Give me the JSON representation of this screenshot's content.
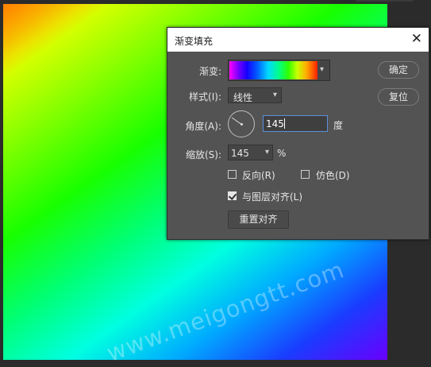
{
  "watermark": "www.meigongtt.com",
  "dialog": {
    "title": "渐变填充",
    "close_glyph": "✕",
    "gradient_label": "渐变:",
    "style_label": "样式(I):",
    "style_value": "线性",
    "angle_label": "角度(A):",
    "angle_value": "145",
    "angle_unit": "度",
    "scale_label": "缩放(S):",
    "scale_value": "145",
    "scale_unit": "%",
    "reverse_label": "反向(R)",
    "reverse_checked": false,
    "dither_label": "仿色(D)",
    "dither_checked": false,
    "align_label": "与图层对齐(L)",
    "align_checked": true,
    "reset_align_label": "重置对齐",
    "ok_label": "确定",
    "reset_label": "复位"
  },
  "icons": {
    "dropdown": "▾"
  }
}
